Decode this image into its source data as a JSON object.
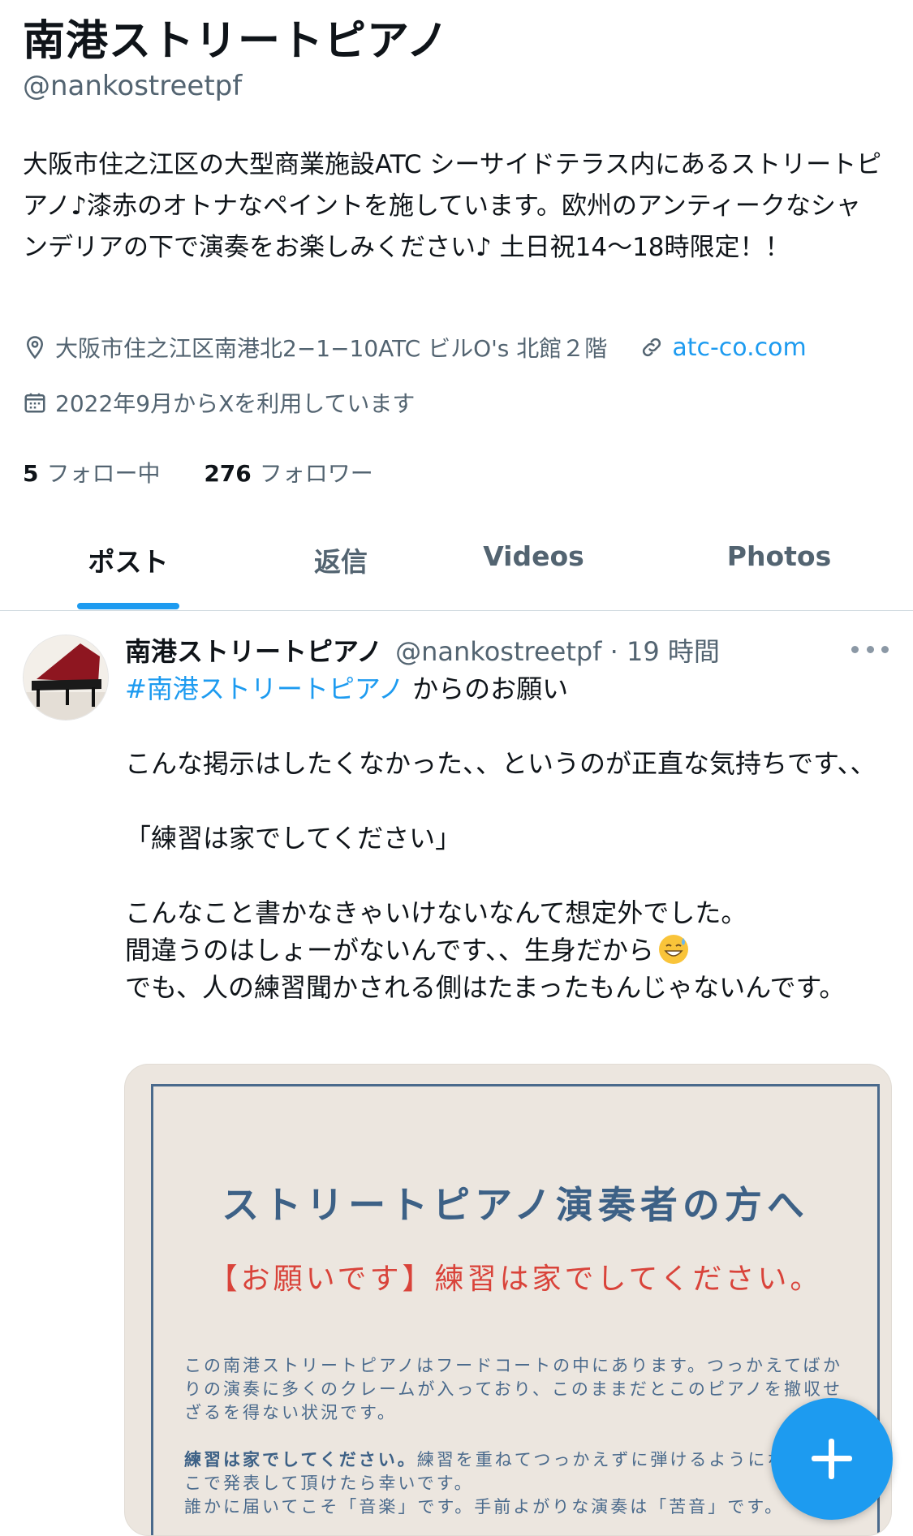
{
  "profile": {
    "name": "南港ストリートピアノ",
    "handle": "@nankostreetpf",
    "bio": "大阪市住之江区の大型商業施設ATC シーサイドテラス内にあるストリートピアノ♪漆赤のオトナなペイントを施しています。欧州のアンティークなシャンデリアの下で演奏をお楽しみください♪ 土日祝14〜18時限定！！",
    "location": "大阪市住之江区南港北2−1−10ATC ビルO's 北館２階",
    "link": "atc-co.com",
    "joined": "2022年9月からXを利用しています",
    "following_count": "5",
    "following_label": "フォロー中",
    "followers_count": "276",
    "followers_label": "フォロワー",
    "icons": {
      "location": "location-pin-icon",
      "link": "link-icon",
      "calendar": "calendar-icon"
    }
  },
  "tabs": [
    {
      "label": "ポスト",
      "active": true
    },
    {
      "label": "返信",
      "active": false
    },
    {
      "label": "Videos",
      "active": false
    },
    {
      "label": "Photos",
      "active": false
    }
  ],
  "tweet": {
    "author_name": "南港ストリートピアノ",
    "author_handle": "@nankostreetpf",
    "time": "· 19 時間",
    "hashtag": "#南港ストリートピアノ",
    "hashtag_suffix": " からのお願い",
    "line1": "こんな掲示はしたくなかった、、というのが正直な気持ちです、、",
    "line2": "「練習は家でしてください」",
    "line3": "こんなこと書かなきゃいけないなんて想定外でした。",
    "line4": "間違うのはしょーがないんです、、生身だから",
    "line5": "でも、人の練習聞かされる側はたまったもんじゃないんです。",
    "emoji": "grinning-face-with-sweat-emoji",
    "more_icon": "more-options-icon"
  },
  "poster": {
    "title": "ストリートピアノ演奏者の方へ",
    "subtitle": "【お願いです】練習は家でしてください。",
    "para1": "この南港ストリートピアノはフードコートの中にあります。つっかえてばかりの演奏に多くのクレームが入っており、このままだとこのピアノを撤収せざるを得ない状況です。",
    "para2_bold": "練習は家でしてください。",
    "para2_rest": "練習を重ねてつっかえずに弾けるようになら、ここで発表して頂けたら幸いです。",
    "para2_line3": "誰かに届いてこそ「音楽」です。手前よがりな演奏は「苦音」です。"
  },
  "fab": {
    "icon": "compose-plus-icon"
  },
  "colors": {
    "accent": "#1d9bf0",
    "text": "#0f1419",
    "secondary": "#536471",
    "poster_blue": "#3d6186",
    "poster_red": "#d9433a"
  }
}
